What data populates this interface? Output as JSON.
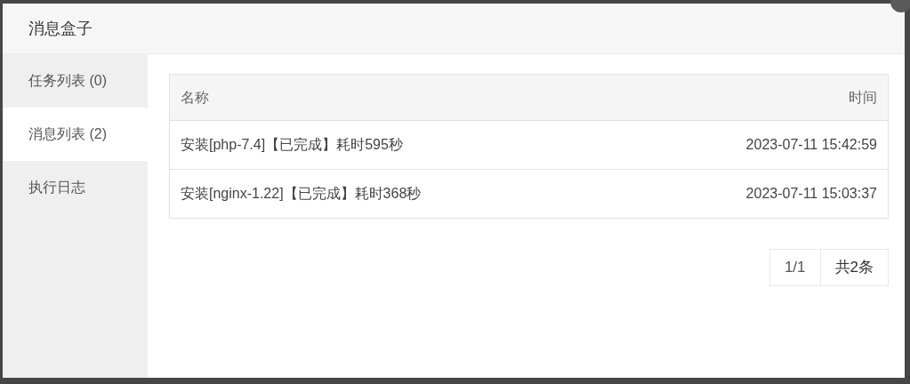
{
  "window": {
    "title": "消息盒子"
  },
  "sidebar": {
    "items": [
      {
        "label": "任务列表 (0)",
        "selected": false
      },
      {
        "label": "消息列表 (2)",
        "selected": true
      },
      {
        "label": "执行日志",
        "selected": false
      }
    ]
  },
  "table": {
    "columns": [
      "名称",
      "时间"
    ],
    "rows": [
      [
        "安装[php-7.4]【已完成】耗时595秒",
        "2023-07-11 15:42:59"
      ],
      [
        "安装[nginx-1.22]【已完成】耗时368秒",
        "2023-07-11 15:03:37"
      ]
    ]
  },
  "pagination": {
    "page": "1/1",
    "total": "共2条"
  }
}
